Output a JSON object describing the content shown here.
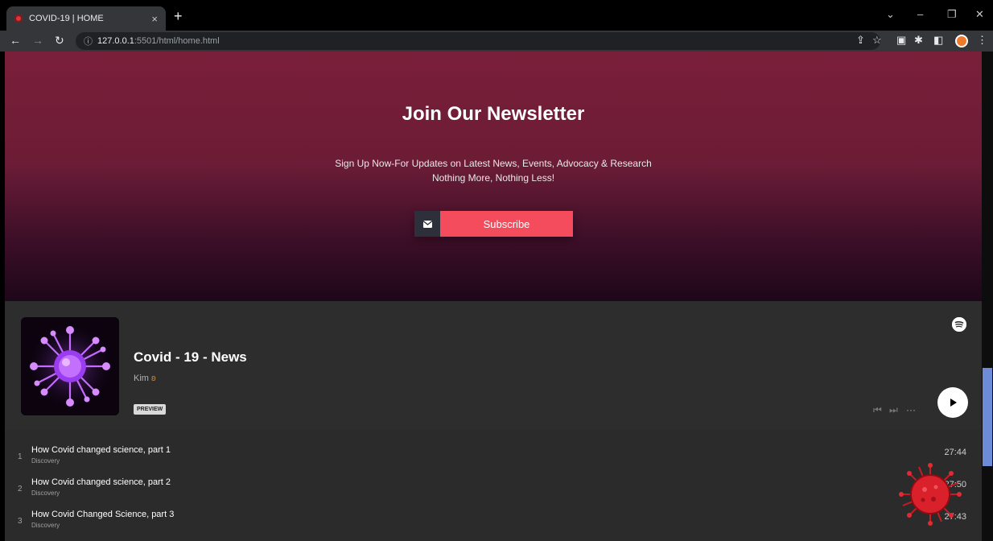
{
  "browser": {
    "tab_title": "COVID-19 | HOME",
    "tab_close": "×",
    "new_tab": "+",
    "url_host": "127.0.0.1",
    "url_path": ":5501/html/home.html",
    "url_info": "ⓘ"
  },
  "newsletter": {
    "title": "Join Our Newsletter",
    "subtitle_line1": "Sign Up Now-For Updates on Latest News, Events, Advocacy & Research",
    "subtitle_line2": "Nothing More, Nothing Less!",
    "subscribe_label": "Subscribe"
  },
  "player": {
    "show_title": "Covid - 19 - News",
    "author": "Kim",
    "preview_badge": "PREVIEW",
    "tracks": [
      {
        "num": "1",
        "title": "How Covid changed science, part 1",
        "subtitle": "Discovery",
        "duration": "27:44"
      },
      {
        "num": "2",
        "title": "How Covid changed science, part 2",
        "subtitle": "Discovery",
        "duration": "27:50"
      },
      {
        "num": "3",
        "title": "How Covid Changed Science, part 3",
        "subtitle": "Discovery",
        "duration": "27:43"
      }
    ]
  },
  "colors": {
    "accent": "#f44c5c",
    "newsletter_bg_top": "#7a1f3a",
    "embed_bg": "#2b2b2b",
    "scroll_thumb": "#6e8bd8"
  }
}
